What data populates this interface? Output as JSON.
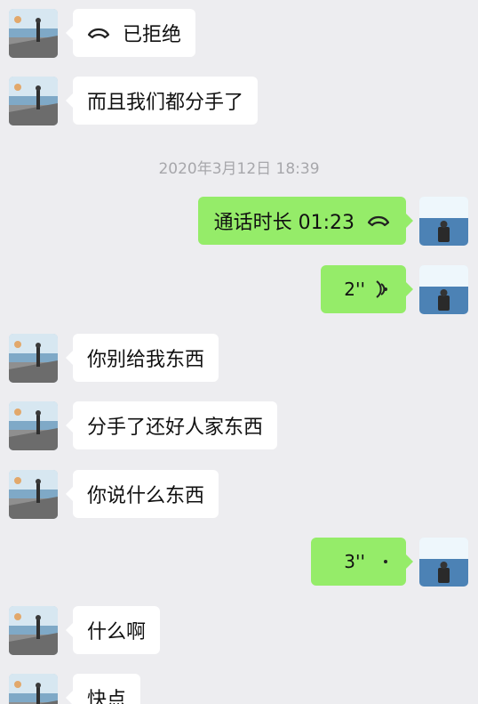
{
  "timestamp": "2020年3月12日 18:39",
  "messages": [
    {
      "side": "left",
      "text": "已拒绝",
      "type": "call"
    },
    {
      "side": "left",
      "text": "而且我们都分手了"
    },
    {
      "side": "right",
      "text": "通话时长 01:23",
      "type": "call"
    },
    {
      "side": "right",
      "text": "2''",
      "type": "voice"
    },
    {
      "side": "left",
      "text": "你别给我东西"
    },
    {
      "side": "left",
      "text": "分手了还好人家东西"
    },
    {
      "side": "left",
      "text": "你说什么东西"
    },
    {
      "side": "right",
      "text": "3''",
      "type": "voice"
    },
    {
      "side": "left",
      "text": "什么啊"
    },
    {
      "side": "left",
      "text": "快点"
    }
  ],
  "colors": {
    "background": "#EDEDF0",
    "received_bubble": "#FFFFFF",
    "sent_bubble": "#95EC69",
    "timestamp_text": "#A7A7AB"
  },
  "icons": {
    "call": "phone-handset-icon",
    "voice": "voice-wave-icon"
  }
}
